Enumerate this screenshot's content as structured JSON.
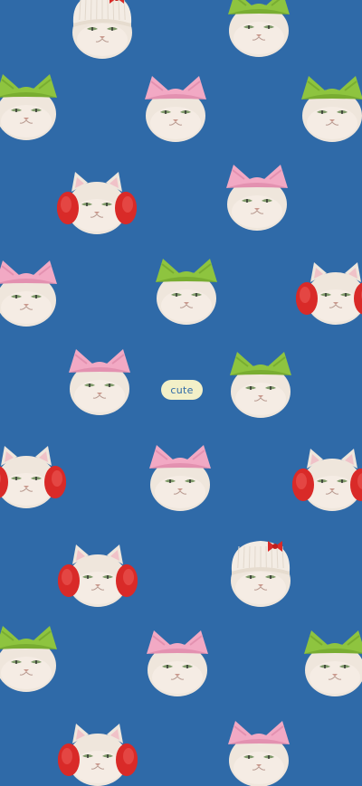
{
  "wallpaper": {
    "background_color": "#2f6aa8",
    "badge": {
      "text": "cute",
      "background_color": "#f3f0c8",
      "text_color": "#2f6aa8"
    },
    "cats": [
      {
        "hat": "knit-beanie-with-bow"
      },
      {
        "hat": "green-cat-ear-headband"
      },
      {
        "hat": "green-cat-ear-headband"
      },
      {
        "hat": "pink-cat-ear-headband"
      },
      {
        "hat": "green-cat-ear-headband"
      },
      {
        "hat": "red-earmuffs"
      },
      {
        "hat": "pink-cat-ear-headband"
      },
      {
        "hat": "pink-cat-ear-headband"
      },
      {
        "hat": "green-cat-ear-headband"
      },
      {
        "hat": "red-earmuffs"
      },
      {
        "hat": "pink-cat-ear-headband"
      },
      {
        "hat": "green-cat-ear-headband"
      },
      {
        "hat": "red-earmuffs"
      },
      {
        "hat": "pink-cat-ear-headband"
      },
      {
        "hat": "red-earmuffs"
      },
      {
        "hat": "red-earmuffs"
      },
      {
        "hat": "knit-beanie-with-bow"
      },
      {
        "hat": "green-cat-ear-headband"
      },
      {
        "hat": "pink-cat-ear-headband"
      },
      {
        "hat": "green-cat-ear-headband"
      },
      {
        "hat": "red-earmuffs"
      },
      {
        "hat": "pink-cat-ear-headband"
      }
    ]
  }
}
